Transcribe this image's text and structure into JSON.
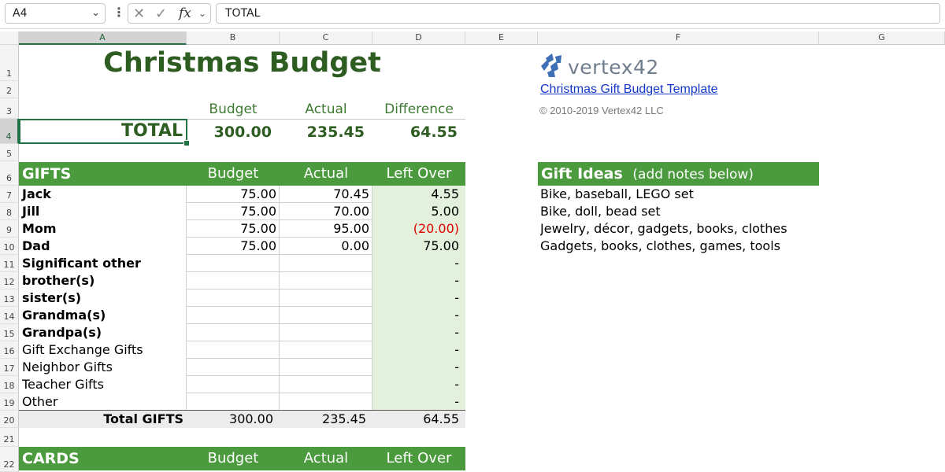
{
  "formula_bar": {
    "name_box": "A4",
    "formula": "TOTAL",
    "fx": "fx"
  },
  "columns": [
    "A",
    "B",
    "C",
    "D",
    "E",
    "F",
    "G"
  ],
  "rows": [
    "1",
    "2",
    "3",
    "4",
    "5",
    "6",
    "7",
    "8",
    "9",
    "10",
    "11",
    "12",
    "13",
    "14",
    "15",
    "16",
    "17",
    "18",
    "19",
    "20",
    "21",
    "22"
  ],
  "title": "Christmas Budget",
  "summary": {
    "headers": [
      "Budget",
      "Actual",
      "Difference"
    ],
    "total_label": "TOTAL",
    "budget": "300.00",
    "actual": "235.45",
    "difference": "64.55"
  },
  "gifts": {
    "header": "GIFTS",
    "col_headers": [
      "Budget",
      "Actual",
      "Left Over"
    ],
    "rows": [
      {
        "name": "Jack",
        "budget": "75.00",
        "actual": "70.45",
        "left": "4.55",
        "bold": true,
        "neg": false
      },
      {
        "name": "Jill",
        "budget": "75.00",
        "actual": "70.00",
        "left": "5.00",
        "bold": true,
        "neg": false
      },
      {
        "name": "Mom",
        "budget": "75.00",
        "actual": "95.00",
        "left": "(20.00)",
        "bold": true,
        "neg": true
      },
      {
        "name": "Dad",
        "budget": "75.00",
        "actual": "0.00",
        "left": "75.00",
        "bold": true,
        "neg": false
      },
      {
        "name": "Significant other",
        "budget": "",
        "actual": "",
        "left": "-",
        "bold": true,
        "neg": false
      },
      {
        "name": "brother(s)",
        "budget": "",
        "actual": "",
        "left": "-",
        "bold": true,
        "neg": false
      },
      {
        "name": "sister(s)",
        "budget": "",
        "actual": "",
        "left": "-",
        "bold": true,
        "neg": false
      },
      {
        "name": "Grandma(s)",
        "budget": "",
        "actual": "",
        "left": "-",
        "bold": true,
        "neg": false
      },
      {
        "name": "Grandpa(s)",
        "budget": "",
        "actual": "",
        "left": "-",
        "bold": true,
        "neg": false
      },
      {
        "name": "Gift Exchange Gifts",
        "budget": "",
        "actual": "",
        "left": "-",
        "bold": false,
        "neg": false
      },
      {
        "name": "Neighbor Gifts",
        "budget": "",
        "actual": "",
        "left": "-",
        "bold": false,
        "neg": false
      },
      {
        "name": "Teacher Gifts",
        "budget": "",
        "actual": "",
        "left": "-",
        "bold": false,
        "neg": false
      },
      {
        "name": "Other",
        "budget": "",
        "actual": "",
        "left": "-",
        "bold": false,
        "neg": false
      }
    ],
    "total_label": "Total GIFTS",
    "total_budget": "300.00",
    "total_actual": "235.45",
    "total_left": "64.55"
  },
  "cards": {
    "header": "CARDS",
    "col_headers": [
      "Budget",
      "Actual",
      "Left Over"
    ]
  },
  "gift_ideas": {
    "header": "Gift Ideas",
    "subheader": "(add notes below)",
    "items": [
      "Bike, baseball, LEGO set",
      "Bike, doll, bead set",
      "Jewelry, décor, gadgets, books, clothes",
      "Gadgets, books, clothes, games, tools"
    ]
  },
  "vertex": {
    "logo_text": "vertex42",
    "link": "Christmas Gift Budget Template",
    "copyright": "© 2010-2019 Vertex42 LLC"
  },
  "colors": {
    "accent": "#4b9a3d",
    "title": "#2e5d22",
    "leftover_bg": "#e3f0db",
    "negative": "#e00000",
    "link": "#1538c8"
  }
}
